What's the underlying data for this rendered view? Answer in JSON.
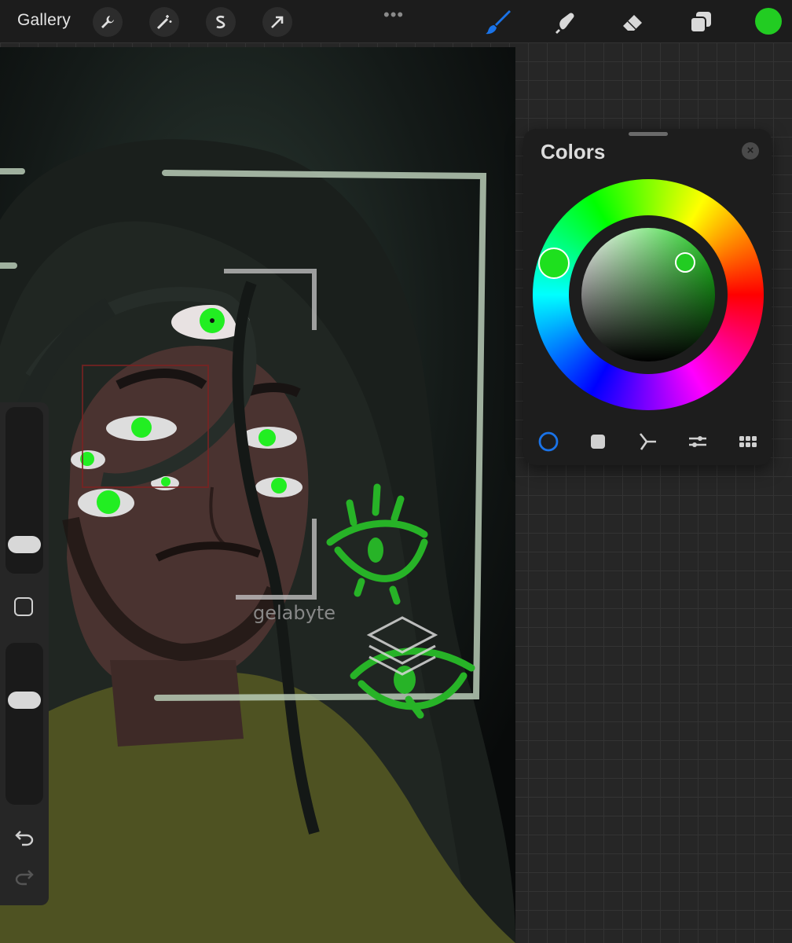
{
  "app": {
    "gallery_label": "Gallery",
    "accent_color": "#1a73e8",
    "current_color": "#22cc22"
  },
  "toolbar_left": [
    {
      "icon": "wrench-icon"
    },
    {
      "icon": "magic-wand-icon"
    },
    {
      "icon": "selection-icon"
    },
    {
      "icon": "transform-arrow-icon"
    }
  ],
  "toolbar_more": "•••",
  "toolbar_right": [
    {
      "icon": "brush-icon",
      "active": true
    },
    {
      "icon": "smudge-icon"
    },
    {
      "icon": "eraser-icon"
    },
    {
      "icon": "layers-icon"
    }
  ],
  "colors_panel": {
    "title": "Colors",
    "close_label": "×",
    "modes": [
      {
        "icon": "disc-mode-icon",
        "active": true
      },
      {
        "icon": "classic-mode-icon"
      },
      {
        "icon": "harmony-mode-icon"
      },
      {
        "icon": "value-mode-icon"
      },
      {
        "icon": "palettes-mode-icon"
      }
    ]
  },
  "artwork": {
    "signature": "gelabyte"
  }
}
